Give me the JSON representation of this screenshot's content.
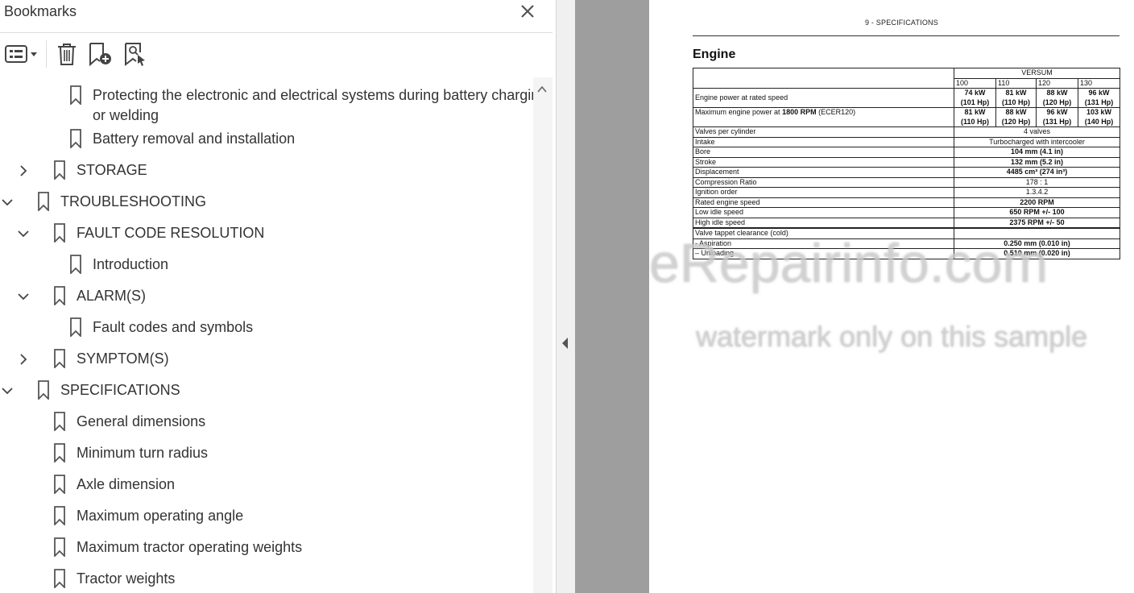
{
  "bookmarks_panel": {
    "title": "Bookmarks",
    "toolbar": {
      "options_icon": "list-options-icon",
      "delete_icon": "trash-icon",
      "new_bookmark_icon": "bookmark-add-icon",
      "find_bookmark_icon": "bookmark-search-icon"
    },
    "items": [
      {
        "label": "Protecting the electronic and electrical systems during battery charging",
        "label2": "or welding",
        "level": 2,
        "expander": "none"
      },
      {
        "label": "Battery removal and installation",
        "level": 2,
        "expander": "none"
      },
      {
        "label": "STORAGE",
        "level": 1,
        "expander": "collapsed"
      },
      {
        "label": "TROUBLESHOOTING",
        "level": 0,
        "expander": "expanded"
      },
      {
        "label": "FAULT CODE RESOLUTION",
        "level": 1,
        "expander": "expanded"
      },
      {
        "label": "Introduction",
        "level": 2,
        "expander": "none"
      },
      {
        "label": "ALARM(S)",
        "level": 1,
        "expander": "expanded"
      },
      {
        "label": "Fault codes and symbols",
        "level": 2,
        "expander": "none"
      },
      {
        "label": "SYMPTOM(S)",
        "level": 1,
        "expander": "collapsed"
      },
      {
        "label": "SPECIFICATIONS",
        "level": 0,
        "expander": "expanded"
      },
      {
        "label": "General dimensions",
        "level": 1,
        "expander": "none"
      },
      {
        "label": "Minimum turn radius",
        "level": 1,
        "expander": "none"
      },
      {
        "label": "Axle dimension",
        "level": 1,
        "expander": "none"
      },
      {
        "label": "Maximum operating angle",
        "level": 1,
        "expander": "none"
      },
      {
        "label": "Maximum tractor operating weights",
        "level": 1,
        "expander": "none"
      },
      {
        "label": "Tractor weights",
        "level": 1,
        "expander": "none"
      }
    ]
  },
  "document": {
    "header": "9 - SPECIFICATIONS",
    "section_title": "Engine",
    "table": {
      "group_header": "VERSUM",
      "models": [
        "100",
        "110",
        "120",
        "130"
      ],
      "rows_per_model": [
        {
          "label": "Engine power at rated speed",
          "values": [
            "74 kW",
            "81 kW",
            "88 kW",
            "96 kW"
          ],
          "values2": [
            "(101 Hp)",
            "(110 Hp)",
            "(120 Hp)",
            "(131 Hp)"
          ]
        },
        {
          "label_a": "Maximum engine power at ",
          "label_b": "1800 RPM",
          "label_c": " (ECER120)",
          "values": [
            "81 kW",
            "88 kW",
            "96 kW",
            "103 kW"
          ],
          "values2": [
            "(110 Hp)",
            "(120 Hp)",
            "(131 Hp)",
            "(140 Hp)"
          ]
        }
      ],
      "rows_all": [
        {
          "label": "Valves per cylinder",
          "value": "4 valves",
          "bold": false
        },
        {
          "label": "Intake",
          "value": "Turbocharged with intercooler",
          "bold": false
        },
        {
          "label": "Bore",
          "value": "104 mm (4.1 in)",
          "bold": true
        },
        {
          "label": "Stroke",
          "value": "132 mm (5.2 in)",
          "bold": true
        },
        {
          "label": "Displacement",
          "value": "4485 cm³ (274 in³)",
          "bold": true
        },
        {
          "label": "Compression Ratio",
          "value": "178 :  1",
          "bold": false
        },
        {
          "label": "Ignition order",
          "value": "1.3.4.2",
          "bold": false
        },
        {
          "label": "Rated engine speed",
          "value": "2200 RPM",
          "bold": true
        },
        {
          "label": "Low idle speed",
          "value": "650 RPM +/- 100",
          "bold": true
        },
        {
          "label": "High idle speed",
          "value": "2375 RPM +/- 50",
          "bold": true
        }
      ],
      "valve_header": "Valve tappet clearance (cold)",
      "valve_rows": [
        {
          "label": "- Aspiration",
          "value": "0.250 mm (0.010 in)"
        },
        {
          "label": "– Unloading",
          "value": "0.510 mm (0.020 in)"
        }
      ]
    },
    "watermark_line1": "eRepairinfo.com",
    "watermark_line2": "watermark only on this sample"
  }
}
